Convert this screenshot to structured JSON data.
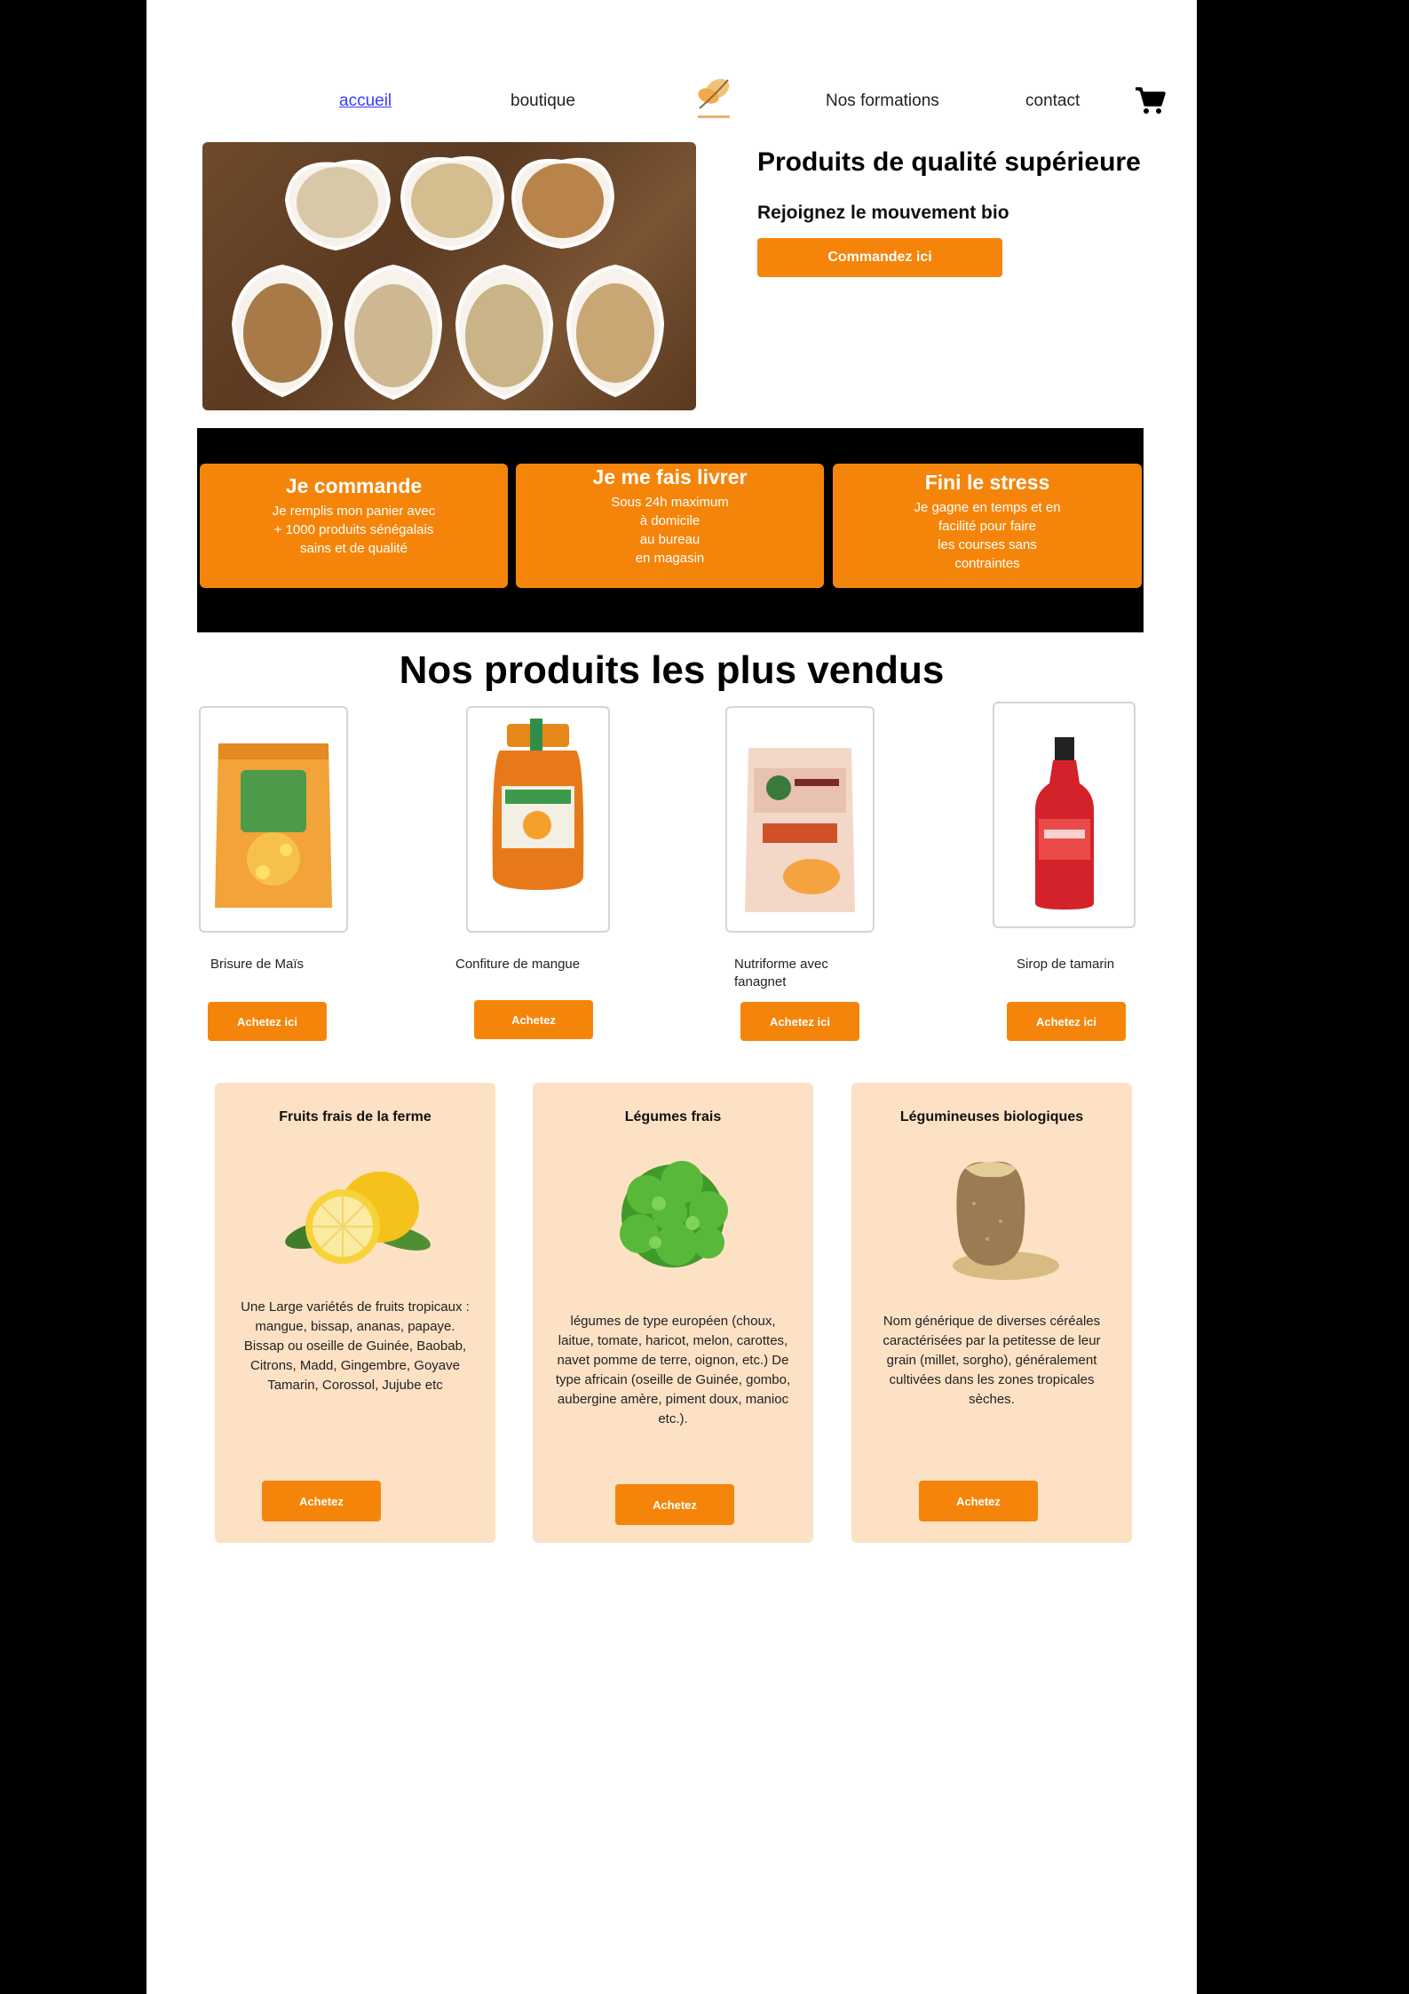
{
  "nav": {
    "home": "accueil",
    "shop": "boutique",
    "training": "Nos formations",
    "contact": "contact",
    "cart_icon": "cart-icon",
    "logo_icon": "leaf-logo"
  },
  "hero": {
    "title": "Produits de qualité supérieure",
    "subtitle": "Rejoignez le mouvement bio",
    "cta": "Commandez ici",
    "image": "grain-bowls-photo"
  },
  "benefits": [
    {
      "title": "Je  commande",
      "text": "Je remplis mon panier avec\n+ 1000 produits sénégalais\nsains et de qualité"
    },
    {
      "title": "Je me fais livrer",
      "text": "Sous 24h maximum\nà domicile\nau bureau\nen magasin"
    },
    {
      "title": "Fini le stress",
      "text": "Je gagne en temps et en\nfacilité pour faire\nles courses sans\ncontraintes"
    }
  ],
  "bestsellers": {
    "title": "Nos produits les plus vendus",
    "items": [
      {
        "name": "Brisure de Maïs",
        "button": "Achetez ici",
        "image": "corn-bag-photo"
      },
      {
        "name": "Confiture de mangue",
        "button": "Achetez",
        "image": "mango-jam-jar-photo"
      },
      {
        "name": "Nutriforme avec fanagnet",
        "button": "Achetez ici",
        "image": "nutriforme-pack-photo"
      },
      {
        "name": "Sirop de tamarin",
        "button": "Achetez ici",
        "image": "syrup-bottle-photo"
      }
    ]
  },
  "categories": [
    {
      "title": "Fruits frais de la ferme",
      "description": "Une Large variétés de fruits tropicaux : mangue, bissap, ananas, papaye. Bissap ou oseille de Guinée, Baobab, Citrons, Madd, Gingembre, Goyave Tamarin, Corossol, Jujube etc",
      "button": "Achetez",
      "image": "lemons-photo"
    },
    {
      "title": "Légumes frais",
      "description": "légumes de type européen (choux, laitue, tomate, haricot, melon, carottes, navet pomme de terre, oignon, etc.) De type africain (oseille de Guinée, gombo, aubergine amère, piment doux, manioc etc.).",
      "button": "Achetez",
      "image": "lettuce-photo"
    },
    {
      "title": "Légumineuses biologiques",
      "description": "Nom générique de diverses céréales caractérisées par la petitesse de leur grain (millet, sorgho), généralement cultivées dans les zones tropicales sèches.",
      "button": "Achetez",
      "image": "grain-sack-photo"
    }
  ],
  "colors": {
    "accent": "#f5850a",
    "category_bg": "#fde1c5",
    "band": "#000000",
    "nav_active": "#3a3aff"
  }
}
